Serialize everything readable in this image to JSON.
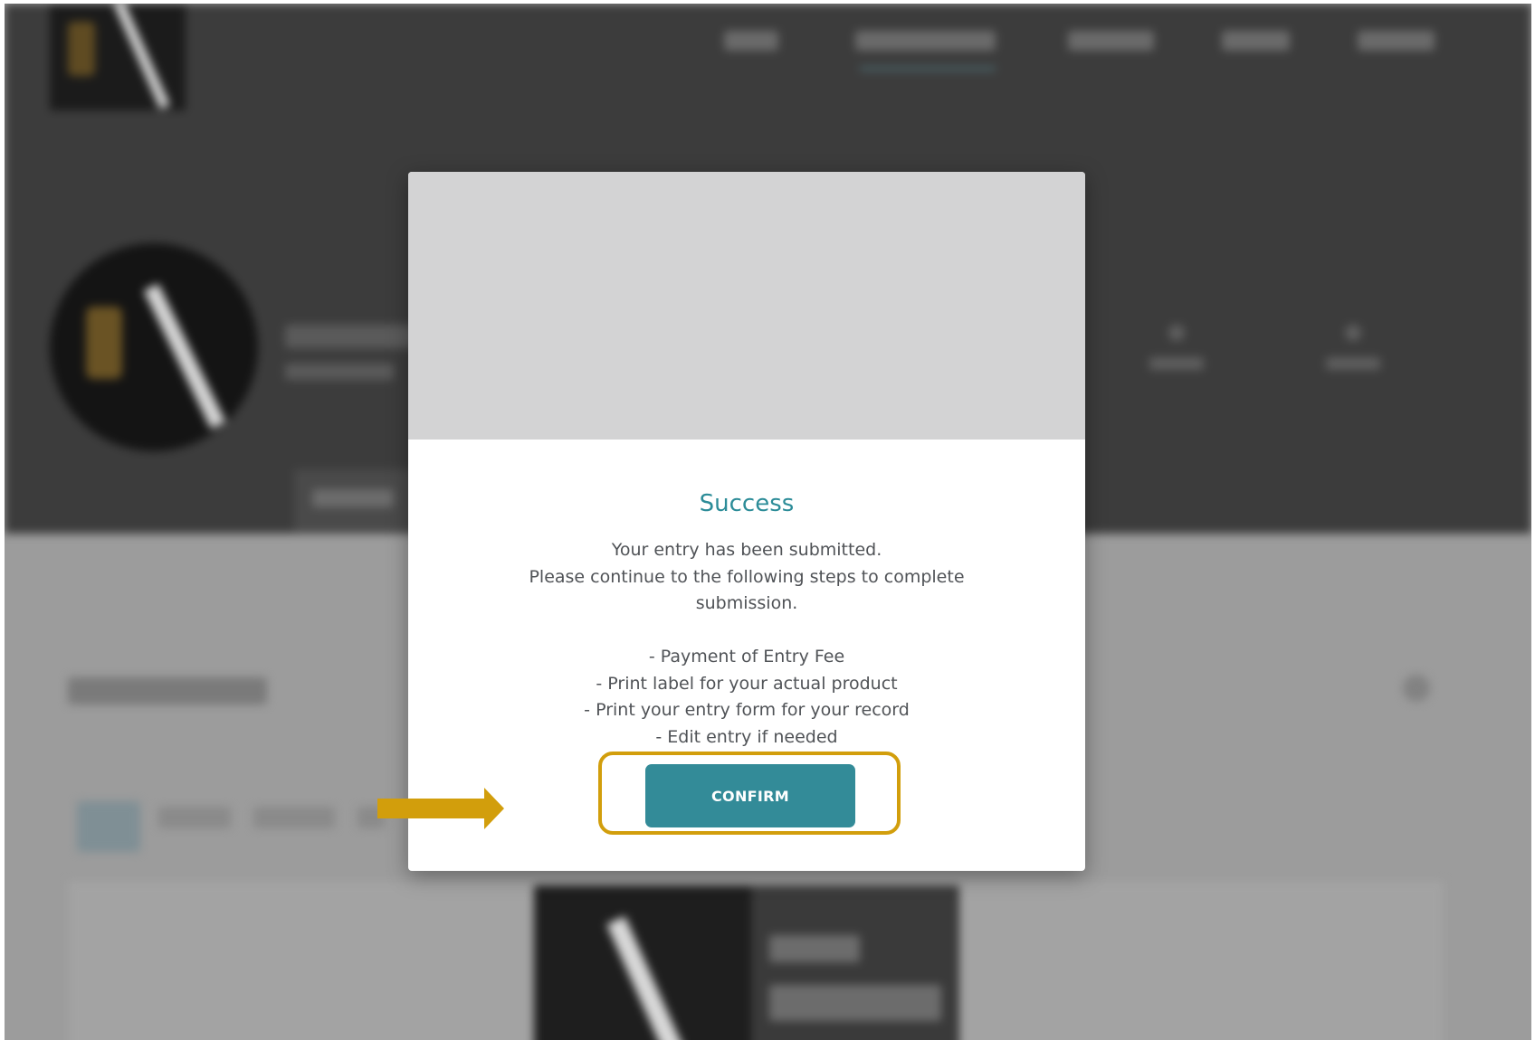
{
  "modal": {
    "title": "Success",
    "message_lines": [
      "Your entry has been submitted.",
      "Please continue to the following steps to complete submission."
    ],
    "steps": [
      "- Payment of Entry Fee",
      "- Print label for your actual product",
      "- Print your entry form for your record",
      "- Edit entry if needed"
    ],
    "confirm_label": "CONFIRM"
  },
  "colors": {
    "accent": "#2c8c98",
    "button": "#338b98",
    "annotation": "#d29e0c",
    "overlay_header": "#3c3c3c",
    "overlay_body": "#9c9c9c"
  },
  "icons": {
    "annotation_arrow": "arrow-right-icon"
  }
}
